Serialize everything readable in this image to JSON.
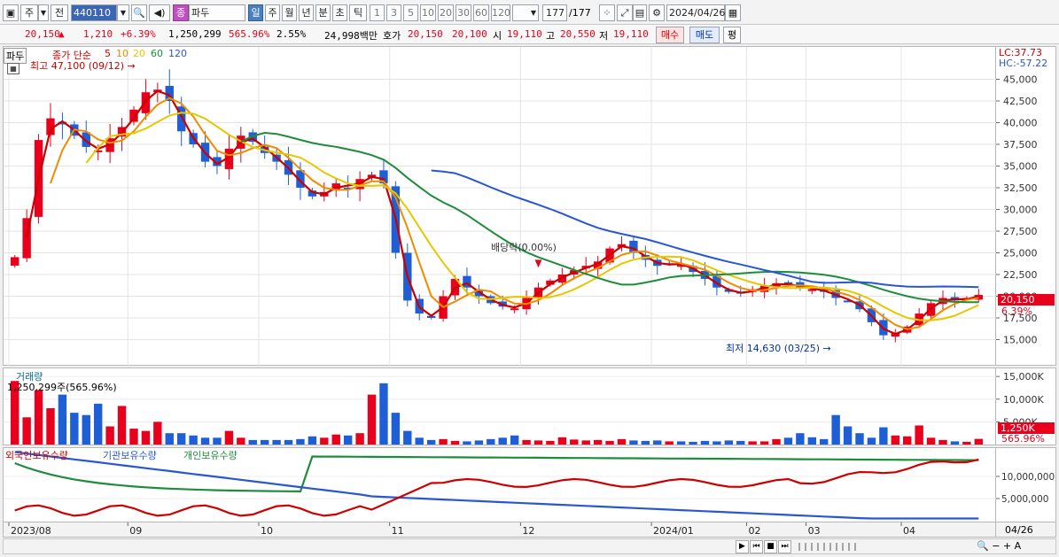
{
  "toolbar": {
    "market": "주",
    "all": "전",
    "code": "440110",
    "stock_tag": "종",
    "stock_name": "파두",
    "periods": [
      "일",
      "주",
      "월",
      "년",
      "분",
      "초",
      "틱"
    ],
    "period_selected": "일",
    "intervals": [
      "1",
      "3",
      "5",
      "10",
      "20",
      "30",
      "60",
      "120"
    ],
    "count": "177",
    "total": "/177",
    "date": "2024/04/26"
  },
  "quote": {
    "price": "20,150",
    "arrow": "▲",
    "change": "1,210",
    "change_pct": "+6.39%",
    "volume": "1,250,299",
    "volume_ratio": "565.96%",
    "turnover": "2.55%",
    "amount": "24,998백만",
    "ask_label": "호가",
    "ask": "20,150",
    "bid": "20,100",
    "open_label": "시",
    "open": "19,110",
    "high_label": "고",
    "high": "20,550",
    "low_label": "저",
    "low": "19,110",
    "buy": "매수",
    "sell": "매도",
    "eval": "평"
  },
  "price_pane": {
    "name": "파두",
    "legend_prefix": "종가 단순",
    "ma_periods": [
      "5",
      "10",
      "20",
      "60",
      "120"
    ],
    "ma_colors": [
      "#cc0000",
      "#f08c00",
      "#e6c800",
      "#1e8c3c",
      "#2a56d0"
    ],
    "high_note": "최고 47,100 (09/12) →",
    "low_note": "최저 14,630 (03/25) →",
    "dividend_note": "배당락(0.00%)",
    "lc": "LC:37.73",
    "hc": "HC:-57.22",
    "price_tag": "20,150",
    "pct_tag": "6.39%",
    "y_ticks": [
      "45,000",
      "42,500",
      "40,000",
      "37,500",
      "35,000",
      "32,500",
      "30,000",
      "27,500",
      "25,000",
      "22,500",
      "20,000",
      "17,500",
      "15,000"
    ]
  },
  "volume_pane": {
    "title": "거래량",
    "info": "1,250,299주(565.96%)",
    "y_ticks": [
      "15,000K",
      "10,000K",
      "5,000K"
    ],
    "tag": "1,250K",
    "tag_pct": "565.96%"
  },
  "holding_pane": {
    "legend": [
      "외국인보유수량",
      "기관보유수량",
      "개인보유수량"
    ],
    "colors": [
      "#cc0000",
      "#2a56d0",
      "#1e8c3c"
    ],
    "y_ticks": [
      "10,000,000",
      "5,000,000"
    ]
  },
  "x_axis": {
    "labels": [
      "2023/08",
      "09",
      "10",
      "11",
      "12",
      "2024/01",
      "02",
      "03",
      "04"
    ],
    "right_label": "04/26"
  },
  "chart_data": [
    {
      "type": "line",
      "title": "",
      "series": [
        {
          "name": "5",
          "values": [
            24500,
            29000,
            38000,
            40500,
            39800,
            38500,
            37200,
            36800,
            38200,
            39500,
            41500,
            43500,
            43800,
            42500,
            39000,
            37500,
            35500,
            35000,
            37000,
            38500,
            37800,
            36500,
            35500,
            34000,
            32500,
            31500,
            32000,
            33000,
            32500,
            33500,
            34000,
            33000,
            25000,
            19500,
            18000,
            17500,
            20000,
            22000,
            21000,
            20000,
            19200,
            18800,
            18600,
            19800,
            21000,
            21800,
            22500,
            23000,
            23500,
            24000,
            25500,
            26000,
            25000,
            24200,
            23500,
            23800,
            23600,
            22800,
            22000,
            21000,
            20500,
            20300,
            20800,
            21200,
            21500,
            21300,
            21000,
            20800,
            20500,
            19800,
            19500,
            18500,
            17000,
            15500,
            15800,
            16500,
            18000,
            19200,
            19800,
            19500,
            19800,
            20150
          ]
        }
      ]
    },
    {
      "type": "bar",
      "title": "거래량",
      "series": [
        {
          "name": "거래량",
          "values": [
            14000,
            6000,
            12000,
            8000,
            11000,
            7000,
            6500,
            9000,
            4000,
            8500,
            3500,
            3000,
            5000,
            2500,
            2500,
            2000,
            1500,
            1500,
            3000,
            1500,
            1000,
            1000,
            1000,
            1000,
            1200,
            1800,
            1500,
            2200,
            2000,
            2500,
            11000,
            13500,
            7000,
            3000,
            1500,
            1000,
            1200,
            800,
            700,
            900,
            1200,
            1500,
            2000,
            1000,
            900,
            800,
            1600,
            1100,
            900,
            1000,
            800,
            1200,
            900,
            800,
            900,
            700,
            700,
            600,
            800,
            700,
            900,
            800,
            700,
            700,
            1200,
            1500,
            2500,
            1600,
            1200,
            6500,
            4000,
            2500,
            1500,
            3800,
            2000,
            1800,
            4200,
            1500,
            1000,
            700,
            600,
            1250
          ]
        }
      ]
    }
  ]
}
